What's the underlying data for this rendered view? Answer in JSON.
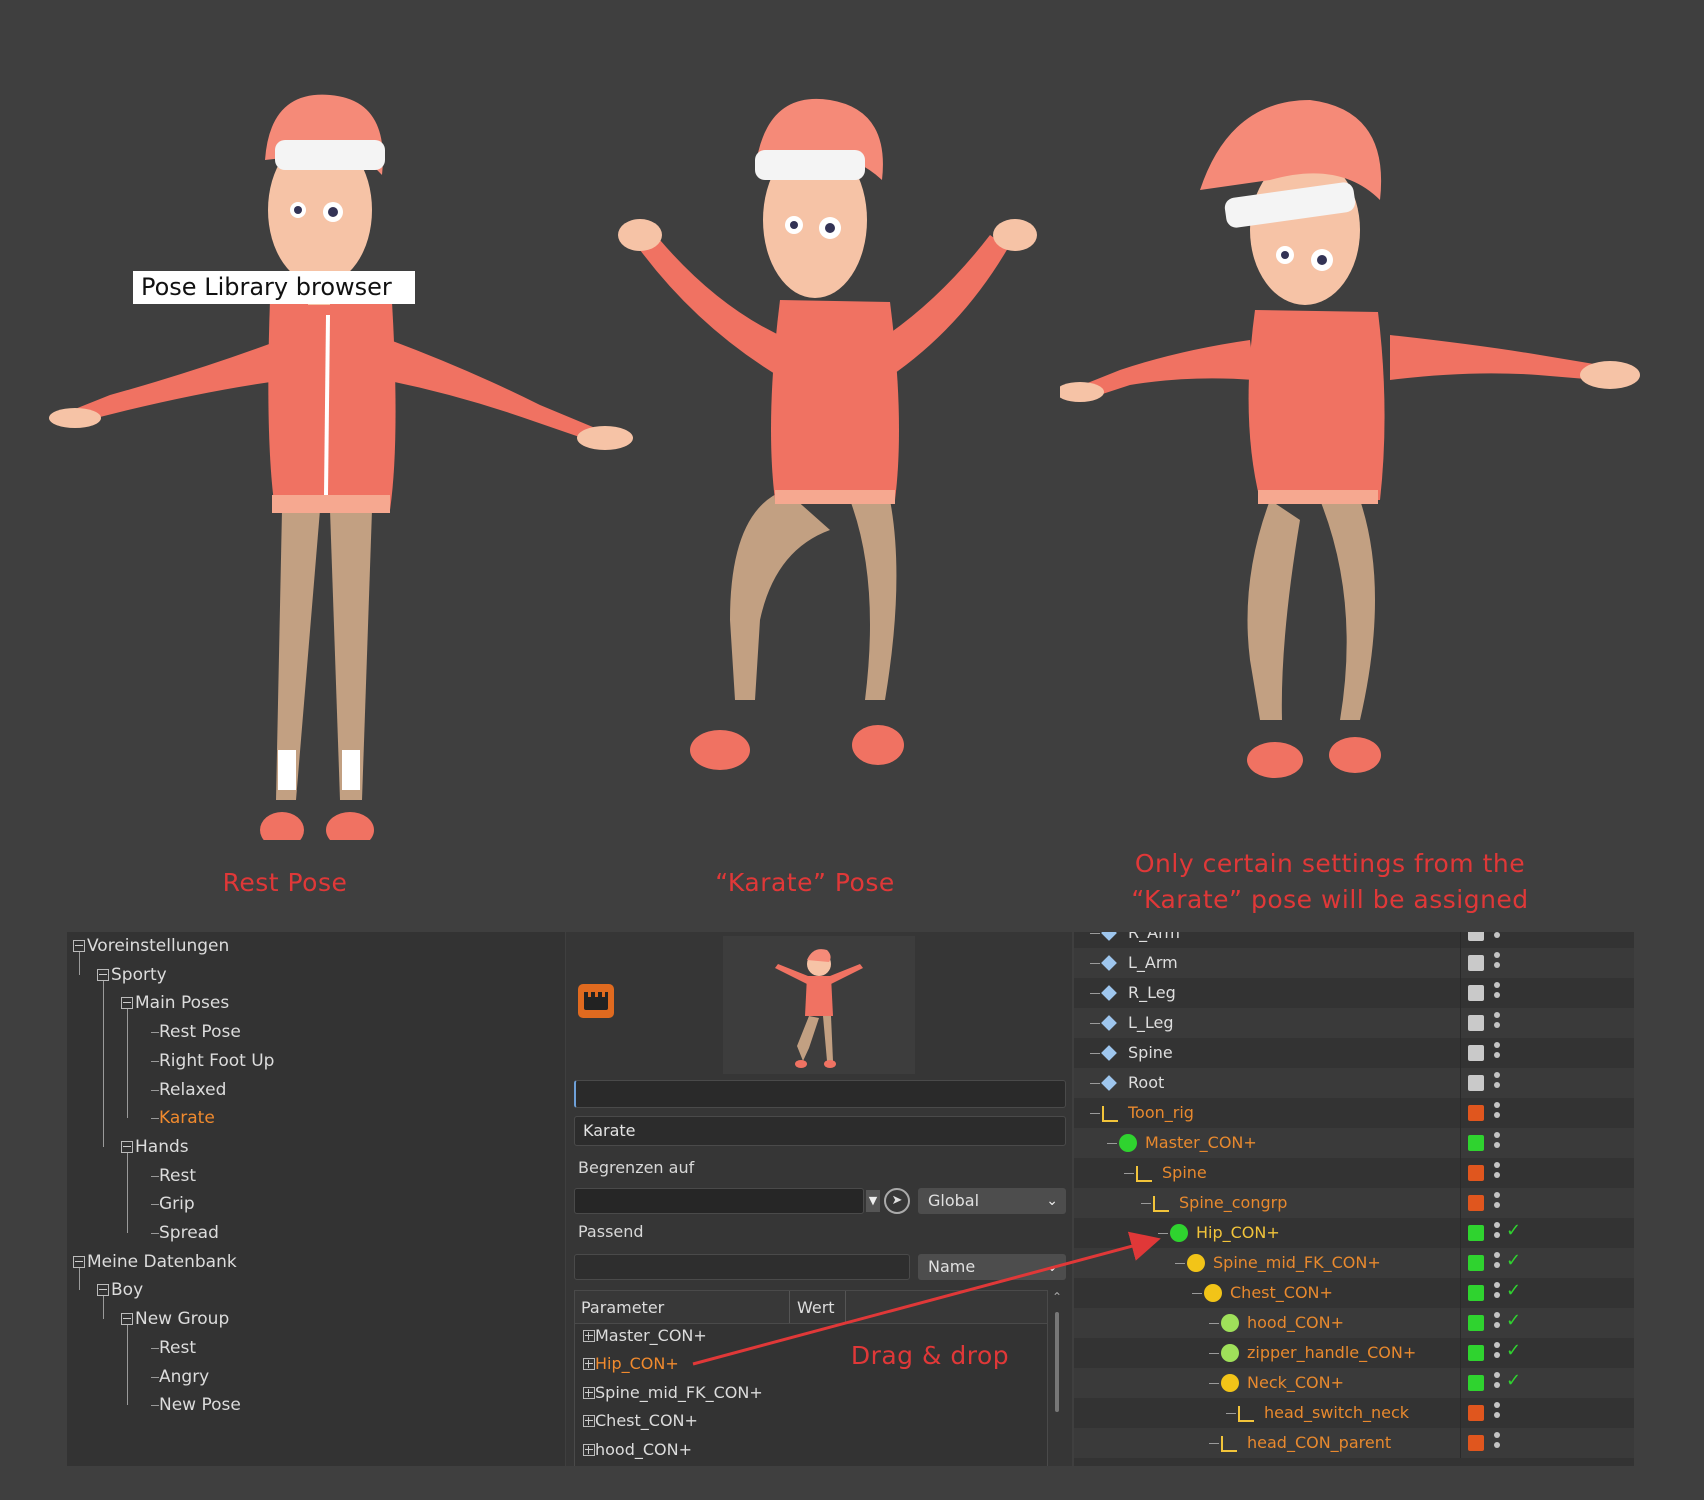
{
  "scene": {
    "callout": "Pose Library browser",
    "captions": {
      "rest": "Rest Pose",
      "karate": "“Karate” Pose",
      "note_line1": "Only certain settings from the",
      "note_line2": "“Karate” pose will be assigned"
    },
    "drag_label": "Drag & drop",
    "colors": {
      "background": "#3f3f3f",
      "caption": "#e03838",
      "skin": "#f6c3a6",
      "hoodie": "#f07262",
      "hair": "#f58a78",
      "pants": "#c2a082"
    }
  },
  "pose_tree": {
    "items": [
      {
        "label": "Voreinstellungen",
        "level": 0
      },
      {
        "label": "Sporty",
        "level": 1
      },
      {
        "label": "Main Poses",
        "level": 2
      },
      {
        "label": "Rest Pose",
        "level": 3
      },
      {
        "label": "Right Foot Up",
        "level": 3
      },
      {
        "label": "Relaxed",
        "level": 3
      },
      {
        "label": "Karate",
        "level": 3,
        "selected": true
      },
      {
        "label": "Hands",
        "level": 2
      },
      {
        "label": "Rest",
        "level": 3
      },
      {
        "label": "Grip",
        "level": 3
      },
      {
        "label": "Spread",
        "level": 3
      },
      {
        "label": "Meine Datenbank",
        "level": 0
      },
      {
        "label": "Boy",
        "level": 1
      },
      {
        "label": "New Group",
        "level": 2
      },
      {
        "label": "Rest",
        "level": 3
      },
      {
        "label": "Angry",
        "level": 3
      },
      {
        "label": "New Pose",
        "level": 3
      }
    ]
  },
  "pose_panel": {
    "icon": "clapperboard-icon",
    "name_value": "Karate",
    "limit_label": "Begrenzen auf",
    "limit_combo": "Global",
    "match_label": "Passend",
    "match_combo": "Name",
    "columns": [
      "Parameter",
      "Wert"
    ],
    "params": [
      {
        "label": "Master_CON+"
      },
      {
        "label": "Hip_CON+",
        "selected": true
      },
      {
        "label": "Spine_mid_FK_CON+"
      },
      {
        "label": "Chest_CON+"
      },
      {
        "label": "hood_CON+"
      }
    ]
  },
  "hierarchy": {
    "rows": [
      {
        "label": "R_Arm",
        "indent": 0,
        "icon": "joint-icon",
        "color": "white",
        "tag": "grey"
      },
      {
        "label": "L_Arm",
        "indent": 0,
        "icon": "joint-icon",
        "color": "white",
        "tag": "grey"
      },
      {
        "label": "R_Leg",
        "indent": 0,
        "icon": "joint-icon",
        "color": "white",
        "tag": "grey"
      },
      {
        "label": "L_Leg",
        "indent": 0,
        "icon": "joint-icon",
        "color": "white",
        "tag": "grey"
      },
      {
        "label": "Spine",
        "indent": 0,
        "icon": "joint-icon",
        "color": "white",
        "tag": "grey"
      },
      {
        "label": "Root",
        "indent": 0,
        "icon": "joint-icon",
        "color": "white",
        "tag": "grey"
      },
      {
        "label": "Toon_rig",
        "indent": 0,
        "icon": "null-icon",
        "color": "orange",
        "tag": "orange"
      },
      {
        "label": "Master_CON+",
        "indent": 1,
        "icon": "green-sphere-icon",
        "color": "orange",
        "tag": "green",
        "check": false
      },
      {
        "label": "Spine",
        "indent": 2,
        "icon": "null-icon",
        "color": "orange",
        "tag": "orange"
      },
      {
        "label": "Spine_congrp",
        "indent": 3,
        "icon": "null-icon",
        "color": "orange",
        "tag": "orange"
      },
      {
        "label": "Hip_CON+",
        "indent": 4,
        "icon": "green-sphere-icon",
        "color": "yellow",
        "tag": "green",
        "check": true
      },
      {
        "label": "Spine_mid_FK_CON+",
        "indent": 5,
        "icon": "yellow-sphere-icon",
        "color": "orange",
        "tag": "green",
        "check": true
      },
      {
        "label": "Chest_CON+",
        "indent": 6,
        "icon": "yellow-sphere-icon",
        "color": "orange",
        "tag": "green",
        "check": true
      },
      {
        "label": "hood_CON+",
        "indent": 7,
        "icon": "lightgreen-sphere-icon",
        "color": "orange",
        "tag": "green",
        "check": true
      },
      {
        "label": "zipper_handle_CON+",
        "indent": 7,
        "icon": "lightgreen-sphere-icon",
        "color": "orange",
        "tag": "green",
        "check": true
      },
      {
        "label": "Neck_CON+",
        "indent": 7,
        "icon": "yellow-sphere-icon",
        "color": "orange",
        "tag": "green",
        "check": true
      },
      {
        "label": "head_switch_neck",
        "indent": 8,
        "icon": "null-icon",
        "color": "orange",
        "tag": "orange"
      },
      {
        "label": "head_CON_parent",
        "indent": 7,
        "icon": "null-icon",
        "color": "orange",
        "tag": "orange"
      }
    ]
  }
}
